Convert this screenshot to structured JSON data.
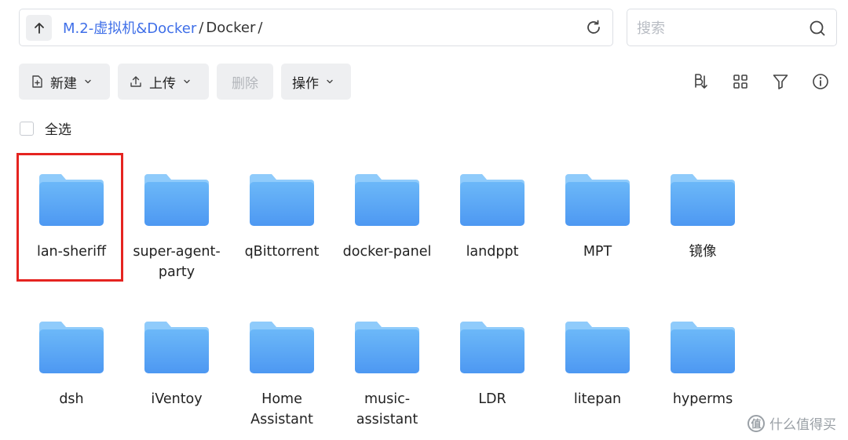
{
  "path": {
    "segments": [
      "M.2-虚拟机&Docker",
      "Docker"
    ],
    "separator": "/"
  },
  "search": {
    "placeholder": "搜索"
  },
  "toolbar": {
    "new_label": "新建",
    "upload_label": "上传",
    "delete_label": "删除",
    "actions_label": "操作"
  },
  "select_all_label": "全选",
  "folders": [
    "lan-sheriff",
    "super-agent-party",
    "qBittorrent",
    "docker-panel",
    "landppt",
    "MPT",
    "镜像",
    "dsh",
    "iVentoy",
    "Home Assistant",
    "music-assistant",
    "LDR",
    "litepan",
    "hyperms"
  ],
  "folder_label_lines": [
    [
      "lan-sheriff"
    ],
    [
      "super-agent-",
      "party"
    ],
    [
      "qBittorrent"
    ],
    [
      "docker-panel"
    ],
    [
      "landppt"
    ],
    [
      "MPT"
    ],
    [
      "镜像"
    ],
    [
      "dsh"
    ],
    [
      "iVentoy"
    ],
    [
      "Home",
      "Assistant"
    ],
    [
      "music-",
      "assistant"
    ],
    [
      "LDR"
    ],
    [
      "litepan"
    ],
    [
      "hyperms"
    ]
  ],
  "selected_folder": "lan-sheriff",
  "colors": {
    "accent": "#3f6fe8",
    "highlight": "#e52420",
    "folder_front": "#5aa8f5",
    "folder_back": "#8fcbfb"
  },
  "watermark": {
    "badge": "值",
    "text": "什么值得买"
  }
}
